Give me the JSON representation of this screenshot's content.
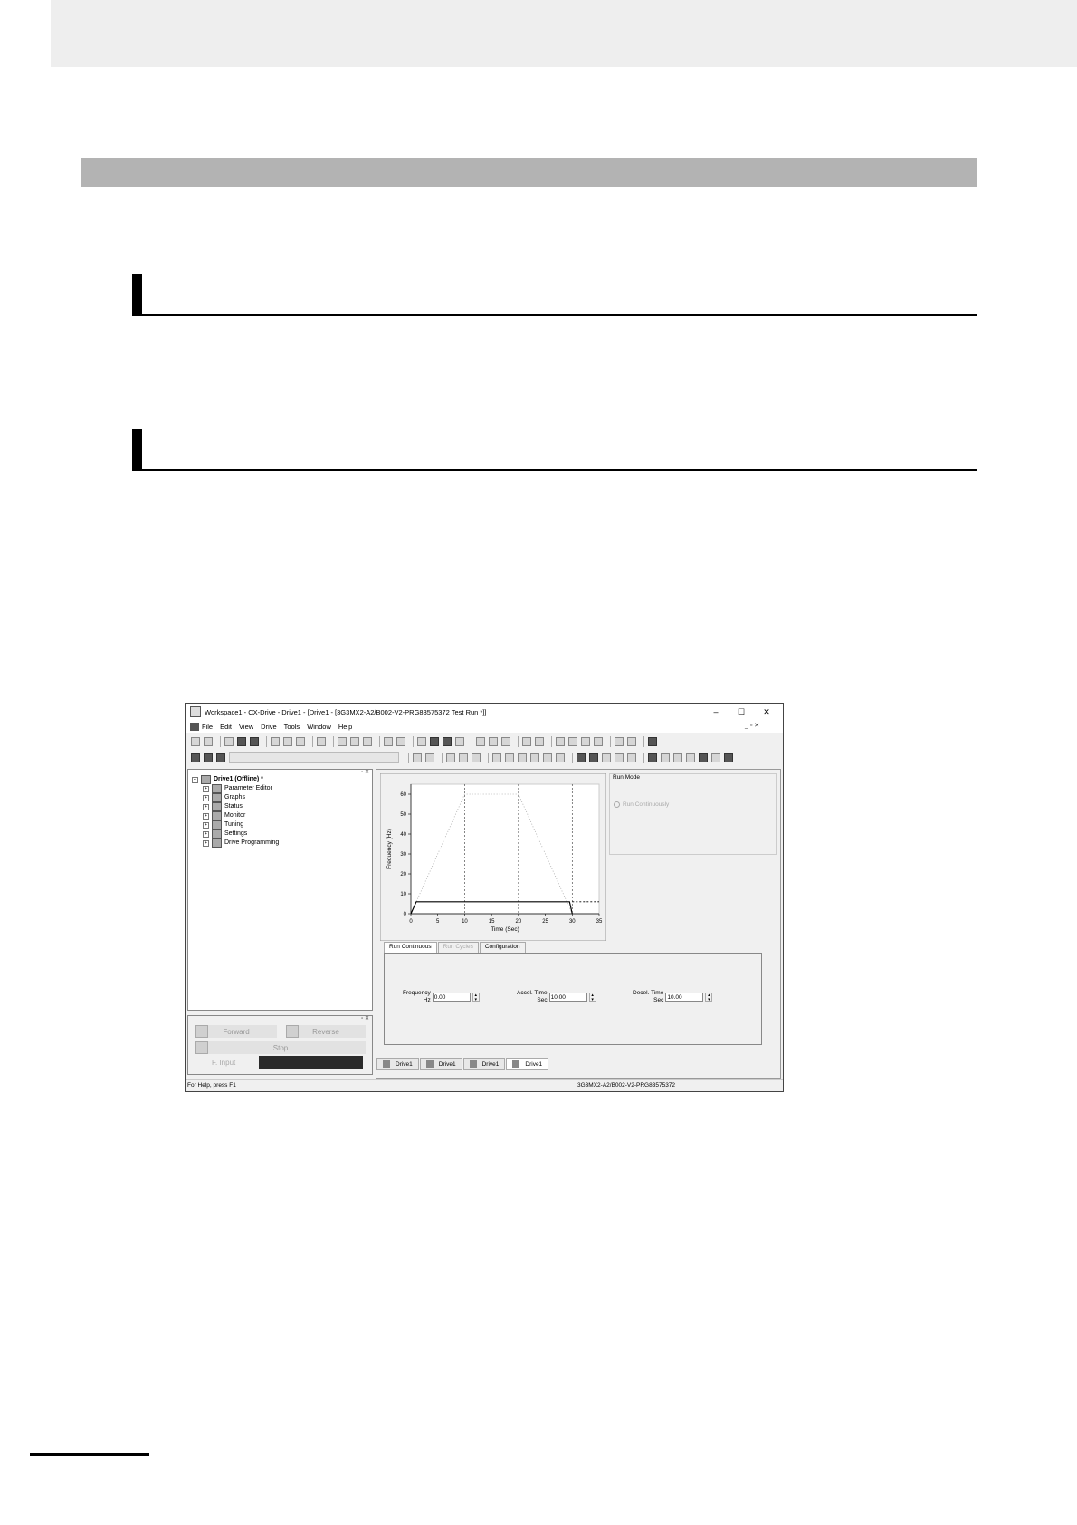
{
  "window": {
    "title": "Workspace1 - CX-Drive - Drive1 - [Drive1 - [3G3MX2-A2/B002-V2-PRG83575372 Test Run *]]",
    "min": "–",
    "max": "☐",
    "close": "✕"
  },
  "menu": [
    "File",
    "Edit",
    "View",
    "Drive",
    "Tools",
    "Window",
    "Help"
  ],
  "mdi_controls": "_ ▫ ✕",
  "tree": {
    "root": "Drive1 (Offline) *",
    "items": [
      "Parameter Editor",
      "Graphs",
      "Status",
      "Monitor",
      "Tuning",
      "Settings",
      "Drive Programming"
    ]
  },
  "controls": {
    "forward": "Forward",
    "reverse": "Reverse",
    "stop": "Stop",
    "f_input": "F. Input"
  },
  "run_mode": {
    "label": "Run Mode",
    "option": "Run Continuously"
  },
  "tabs": [
    "Run Continuous",
    "Run Cycles",
    "Configuration"
  ],
  "fields": [
    {
      "label1": "Frequency",
      "label2": "Hz",
      "value": "0.00"
    },
    {
      "label1": "Accel. Time",
      "label2": "Sec",
      "value": "10.00"
    },
    {
      "label1": "Decel. Time",
      "label2": "Sec",
      "value": "10.00"
    }
  ],
  "doc_tabs": [
    "Drive1",
    "Drive1",
    "Drive1",
    "Drive1"
  ],
  "status": {
    "help": "For Help, press F1",
    "model": "3G3MX2-A2/B002-V2-PRG83575372"
  },
  "chart_data": {
    "type": "line",
    "xlabel": "Time (Sec)",
    "ylabel": "Frequency (Hz)",
    "xlim": [
      0,
      35
    ],
    "ylim": [
      0,
      65
    ],
    "xticks": [
      0,
      5,
      10,
      15,
      20,
      25,
      30,
      35
    ],
    "yticks": [
      0,
      10,
      20,
      30,
      40,
      50,
      60
    ],
    "vlines": [
      10,
      20,
      30
    ],
    "series": [
      {
        "style": "dotted-gray",
        "x": [
          0,
          10,
          20,
          30
        ],
        "y": [
          0,
          60,
          60,
          0
        ]
      },
      {
        "style": "solid-black",
        "x": [
          0,
          1,
          29.5,
          30
        ],
        "y": [
          0,
          6,
          6,
          0
        ]
      },
      {
        "style": "dashed-black",
        "x": [
          30,
          35
        ],
        "y": [
          6,
          6
        ]
      }
    ]
  }
}
